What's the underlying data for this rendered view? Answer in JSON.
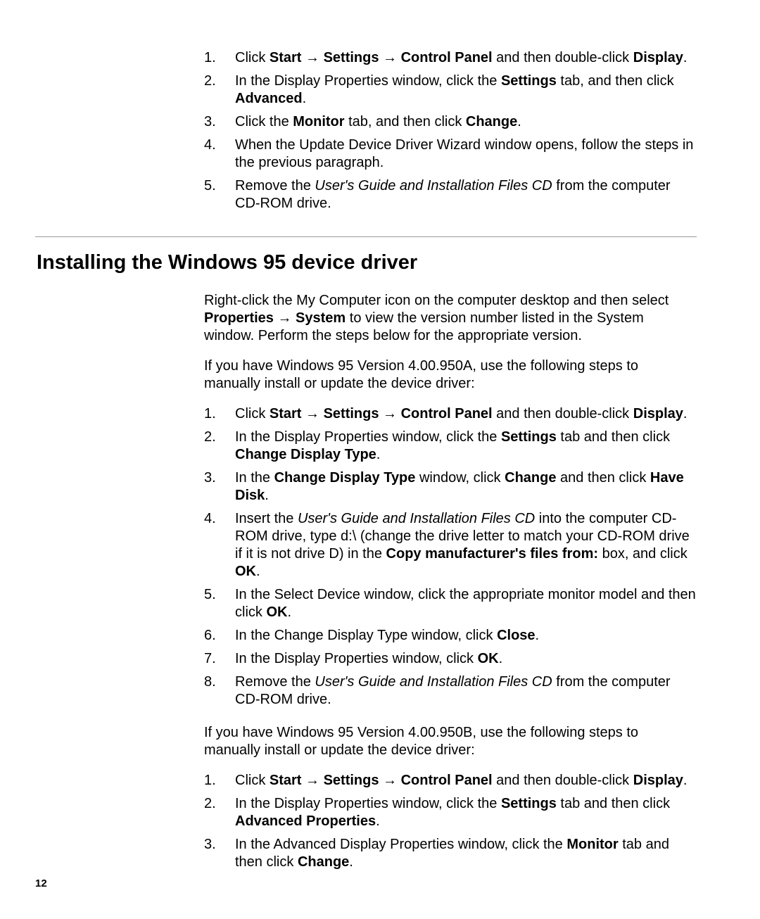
{
  "arrow": "→",
  "listA": {
    "items": [
      {
        "num": "1.",
        "runs": [
          {
            "t": "Click "
          },
          {
            "t": "Start ",
            "b": true
          },
          {
            "t": "→ ",
            "b": true,
            "arrow": true
          },
          {
            "t": "Settings ",
            "b": true
          },
          {
            "t": "→ ",
            "b": true,
            "arrow": true
          },
          {
            "t": "Control Panel",
            "b": true
          },
          {
            "t": " and then double-click "
          },
          {
            "t": "Display",
            "b": true
          },
          {
            "t": "."
          }
        ]
      },
      {
        "num": "2.",
        "runs": [
          {
            "t": "In the Display Properties window, click the "
          },
          {
            "t": "Settings",
            "b": true
          },
          {
            "t": " tab, and then click "
          },
          {
            "t": "Advanced",
            "b": true
          },
          {
            "t": "."
          }
        ]
      },
      {
        "num": "3.",
        "runs": [
          {
            "t": "Click the "
          },
          {
            "t": "Monitor",
            "b": true
          },
          {
            "t": " tab, and then click "
          },
          {
            "t": "Change",
            "b": true
          },
          {
            "t": "."
          }
        ]
      },
      {
        "num": "4.",
        "runs": [
          {
            "t": "When the Update Device Driver Wizard window opens, follow the steps in the previous paragraph."
          }
        ]
      },
      {
        "num": "5.",
        "runs": [
          {
            "t": "Remove the "
          },
          {
            "t": "User's Guide and Installation Files CD",
            "i": true
          },
          {
            "t": " from the computer CD-ROM drive."
          }
        ]
      }
    ]
  },
  "heading": "Installing the Windows 95 device driver",
  "paraIntro": {
    "runs": [
      {
        "t": "Right-click the My Computer icon on the computer desktop and then select "
      },
      {
        "t": "Properties ",
        "b": true
      },
      {
        "t": "→ ",
        "b": true,
        "arrow": true
      },
      {
        "t": "System",
        "b": true
      },
      {
        "t": " to view the version number listed in the System window. Perform the steps below for the appropriate version."
      }
    ]
  },
  "para950A": "If you have Windows 95 Version 4.00.950A, use the following steps to manually install or update the device driver:",
  "listB": {
    "items": [
      {
        "num": "1.",
        "runs": [
          {
            "t": "Click "
          },
          {
            "t": "Start ",
            "b": true
          },
          {
            "t": "→ ",
            "b": true,
            "arrow": true
          },
          {
            "t": "Settings ",
            "b": true
          },
          {
            "t": "→ ",
            "b": true,
            "arrow": true
          },
          {
            "t": "Control Panel",
            "b": true
          },
          {
            "t": " and then double-click "
          },
          {
            "t": "Display",
            "b": true
          },
          {
            "t": "."
          }
        ]
      },
      {
        "num": "2.",
        "runs": [
          {
            "t": "In the Display Properties window, click the "
          },
          {
            "t": "Settings",
            "b": true
          },
          {
            "t": " tab and then click "
          },
          {
            "t": "Change Display Type",
            "b": true
          },
          {
            "t": "."
          }
        ]
      },
      {
        "num": "3.",
        "runs": [
          {
            "t": "In the "
          },
          {
            "t": "Change Display Type",
            "b": true
          },
          {
            "t": " window, click "
          },
          {
            "t": "Change",
            "b": true
          },
          {
            "t": " and then click "
          },
          {
            "t": "Have Disk",
            "b": true
          },
          {
            "t": "."
          }
        ]
      },
      {
        "num": "4.",
        "runs": [
          {
            "t": "Insert the "
          },
          {
            "t": "User's Guide and Installation Files CD",
            "i": true
          },
          {
            "t": " into the computer CD-ROM drive, type d:\\ (change the drive letter to match your CD-ROM drive if it is not drive D) in the "
          },
          {
            "t": "Copy manufacturer's files from:",
            "b": true
          },
          {
            "t": " box, and click "
          },
          {
            "t": "OK",
            "b": true
          },
          {
            "t": "."
          }
        ]
      },
      {
        "num": "5.",
        "runs": [
          {
            "t": "In the Select Device window, click the appropriate monitor model and then click "
          },
          {
            "t": "OK",
            "b": true
          },
          {
            "t": "."
          }
        ]
      },
      {
        "num": "6.",
        "runs": [
          {
            "t": "In the Change Display Type window, click "
          },
          {
            "t": "Close",
            "b": true
          },
          {
            "t": "."
          }
        ]
      },
      {
        "num": "7.",
        "runs": [
          {
            "t": "In the Display Properties window, click "
          },
          {
            "t": "OK",
            "b": true
          },
          {
            "t": "."
          }
        ]
      },
      {
        "num": "8.",
        "runs": [
          {
            "t": "Remove the "
          },
          {
            "t": "User's Guide and Installation Files CD",
            "i": true
          },
          {
            "t": " from the computer CD-ROM drive."
          }
        ]
      }
    ]
  },
  "para950B": "If you have Windows 95 Version 4.00.950B, use the following steps to manually install or update the device driver:",
  "listC": {
    "items": [
      {
        "num": "1.",
        "runs": [
          {
            "t": "Click "
          },
          {
            "t": "Start ",
            "b": true
          },
          {
            "t": "→ ",
            "b": true,
            "arrow": true
          },
          {
            "t": "Settings ",
            "b": true
          },
          {
            "t": "→ ",
            "b": true,
            "arrow": true
          },
          {
            "t": "Control Panel",
            "b": true
          },
          {
            "t": " and then double-click "
          },
          {
            "t": "Display",
            "b": true
          },
          {
            "t": "."
          }
        ]
      },
      {
        "num": "2.",
        "runs": [
          {
            "t": "In the Display Properties window, click the "
          },
          {
            "t": "Settings",
            "b": true
          },
          {
            "t": " tab and then click "
          },
          {
            "t": "Advanced Properties",
            "b": true
          },
          {
            "t": "."
          }
        ]
      },
      {
        "num": "3.",
        "runs": [
          {
            "t": "In the Advanced Display Properties window, click the "
          },
          {
            "t": "Monitor",
            "b": true
          },
          {
            "t": " tab and then click "
          },
          {
            "t": "Change",
            "b": true
          },
          {
            "t": "."
          }
        ]
      }
    ]
  },
  "pageNumber": "12"
}
